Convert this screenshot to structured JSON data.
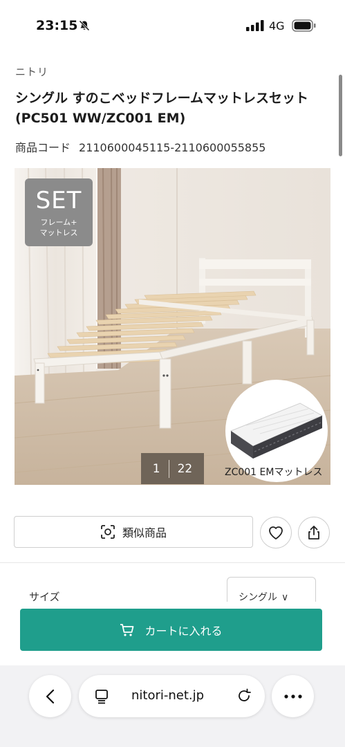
{
  "status_bar": {
    "time": "23:15",
    "network": "4G",
    "icons": [
      "bell-slash-icon",
      "signal-icon",
      "battery-icon"
    ]
  },
  "product": {
    "brand": "ニトリ",
    "title_line1": "シングル すのこベッドフレームマットレスセット",
    "title_line2": "(PC501 WW/ZC001 EM)",
    "code_label": "商品コード",
    "code_value": "2110600045115-2110600055855"
  },
  "image": {
    "badge_title": "SET",
    "badge_sub_line1": "フレーム+",
    "badge_sub_line2": "マットレス",
    "inset_caption": "ZC001 EMマットレス",
    "counter_current": "1",
    "counter_total": "22"
  },
  "actions": {
    "similar_label": "類似商品",
    "favorite_icon": "heart-icon",
    "share_icon": "share-icon"
  },
  "options": {
    "size_label": "サイズ",
    "size_value": "シングル"
  },
  "cart": {
    "label": "カートに入れる",
    "color": "#1f9e8c"
  },
  "browser": {
    "url": "nitori-net.jp",
    "icons": [
      "back-icon",
      "reader-icon",
      "reload-icon",
      "more-icon"
    ]
  }
}
